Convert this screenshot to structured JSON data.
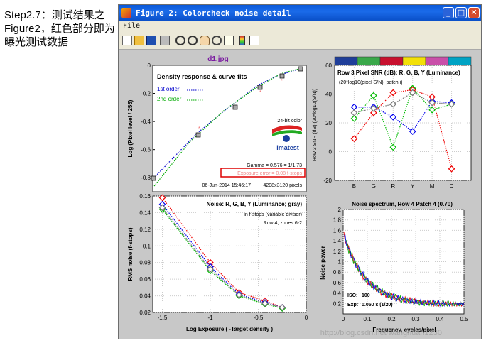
{
  "caption": "Step2.7：测试结果之Figure2，红色部分即为曝光测试数据",
  "window": {
    "title": "Figure 2: Colorcheck noise detail",
    "min": "_",
    "max": "□",
    "close": "✕"
  },
  "menu": {
    "file": "File"
  },
  "toolbar_icons": [
    "new-file-icon",
    "open-folder-icon",
    "save-icon",
    "print-icon",
    "zoom-in-icon",
    "zoom-out-icon",
    "pan-hand-icon",
    "rotate-3d-icon",
    "data-cursor-icon",
    "colorbar-icon",
    "legend-icon"
  ],
  "figure_title": "d1.jpg",
  "chart_data": [
    {
      "type": "line",
      "title": "Density response & curve fits",
      "xlabel": "",
      "ylabel": "Log (Pixel level / 255)",
      "ylim": [
        -0.9,
        0
      ],
      "yticks": [
        "0",
        "-0.2",
        "-0.4",
        "-0.6",
        "-0.8"
      ],
      "series": [
        {
          "name": "1st order",
          "color": "#0000cc",
          "style": "dotted"
        },
        {
          "name": "2nd order",
          "color": "#00aa00",
          "style": "dotted"
        }
      ],
      "annotations": {
        "bitdepth": "24-bit color",
        "logo": "imatest",
        "gamma": "Gamma = 0.576 = 1/1.73",
        "exposure_error": "Exposure error = 0.08 f-stops",
        "timestamp": "06-Jun-2014 15:46:17",
        "size": "4208x3120 pixels"
      }
    },
    {
      "type": "line",
      "title": "Row 3 Pixel SNR (dB): R, G, B, Y (Luminance)",
      "subtitle": "(20*log10(pixel S/N); patch i)",
      "ylabel": "Row 3 SNR (dB) (20*log10(S/N))",
      "ylim": [
        -20,
        60
      ],
      "yticks": [
        "60",
        "40",
        "20",
        "0",
        "-20"
      ],
      "categories": [
        "B",
        "G",
        "R",
        "Y",
        "M",
        "C"
      ],
      "swatches": [
        "#1f3e99",
        "#3aa84a",
        "#c8102e",
        "#f3e007",
        "#c94fa9",
        "#00a3c4"
      ],
      "series": [
        {
          "color": "#0000ee",
          "values": [
            31,
            31,
            24,
            14,
            35,
            34
          ]
        },
        {
          "color": "#00bb00",
          "values": [
            23,
            39,
            3,
            44,
            29,
            33
          ]
        },
        {
          "color": "#ee0000",
          "values": [
            9,
            27,
            41,
            43,
            38,
            -12
          ]
        },
        {
          "color": "#777777",
          "values": [
            27,
            30,
            33,
            41,
            34,
            33
          ]
        }
      ]
    },
    {
      "type": "line",
      "title": "Noise: R, G, B, Y (Luminance; gray)",
      "notes": [
        "in f-stops (variable divisor)",
        "Row 4; zones 6-2"
      ],
      "xlabel": "Log Exposure ( -Target density )",
      "ylabel": "RMS noise (f-stops)",
      "xlim": [
        -1.6,
        0
      ],
      "ylim": [
        0.02,
        0.16
      ],
      "xticks": [
        "-1.5",
        "-1",
        "-0.5",
        "0"
      ],
      "yticks": [
        "0.16",
        "0.14",
        "0.12",
        "0.1",
        "0.08",
        "0.06",
        "0.04",
        "0.02"
      ],
      "x": [
        -1.5,
        -1.0,
        -0.7,
        -0.43,
        -0.25
      ],
      "series": [
        {
          "color": "#ee0000",
          "values": [
            0.158,
            0.08,
            0.044,
            0.034,
            0.026
          ]
        },
        {
          "color": "#0000ee",
          "values": [
            0.15,
            0.075,
            0.042,
            0.032,
            0.026
          ]
        },
        {
          "color": "#00bb00",
          "values": [
            0.144,
            0.07,
            0.04,
            0.03,
            0.025
          ]
        },
        {
          "color": "#777777",
          "values": [
            0.146,
            0.072,
            0.041,
            0.031,
            0.026
          ]
        }
      ]
    },
    {
      "type": "line",
      "title": "Noise spectrum, Row 4 Patch 4 (0.70)",
      "xlabel": "Frequency, cycles/pixel",
      "ylabel": "Noise power",
      "xlim": [
        0,
        0.5
      ],
      "ylim": [
        0,
        2
      ],
      "xticks": [
        "0",
        "0.1",
        "0.2",
        "0.3",
        "0.4",
        "0.5"
      ],
      "yticks": [
        "2",
        "1.8",
        "1.6",
        "1.4",
        "1.2",
        "1",
        "0.8",
        "0.6",
        "0.4",
        "0.2"
      ],
      "iso_label": "ISO:",
      "iso": "100",
      "exp_label": "Exp:",
      "exp": "0.050 s  (1/20)"
    }
  ],
  "watermark": "http://blog.csdn.net/wanghuan1230"
}
